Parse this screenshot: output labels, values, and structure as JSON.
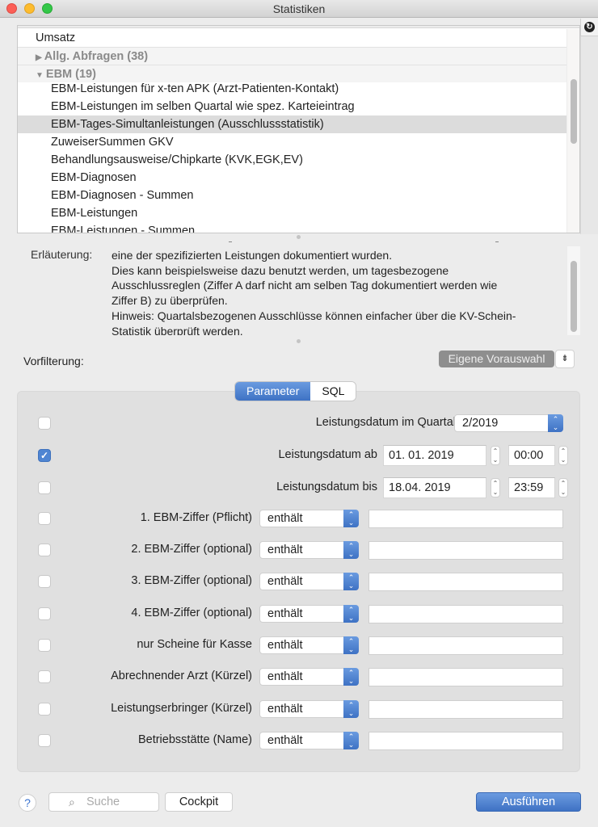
{
  "window": {
    "title": "Statistiken"
  },
  "list": {
    "rows": [
      {
        "label": "Umsatz",
        "kind": "top"
      },
      {
        "label": "Allg. Abfragen (38)",
        "kind": "group",
        "expanded": false,
        "toggle": "▶"
      },
      {
        "label": "EBM (19)",
        "kind": "group",
        "expanded": true,
        "toggle": "▼"
      },
      {
        "label": "EBM-Leistungen für x-ten APK (Arzt-Patienten-Kontakt)",
        "kind": "item"
      },
      {
        "label": "EBM-Leistungen im selben Quartal wie spez. Karteieintrag",
        "kind": "item"
      },
      {
        "label": "EBM-Tages-Simultanleistungen (Ausschlussstatistik)",
        "kind": "item",
        "selected": true
      },
      {
        "label": "ZuweiserSummen GKV",
        "kind": "item"
      },
      {
        "label": "Behandlungsausweise/Chipkarte (KVK,EGK,EV)",
        "kind": "item"
      },
      {
        "label": "EBM-Diagnosen",
        "kind": "item"
      },
      {
        "label": "EBM-Diagnosen - Summen",
        "kind": "item"
      },
      {
        "label": "EBM-Leistungen",
        "kind": "item"
      },
      {
        "label": "EBM-Leistungen - Summen",
        "kind": "item"
      }
    ]
  },
  "icons": {
    "refresh": "↻",
    "checkmark": "✓",
    "popup_arrows": "⌃⌄",
    "stepper_up": "⌃",
    "stepper_down": "⌄",
    "filter_menu": "⇟",
    "help": "?",
    "search": "⌕"
  },
  "description": {
    "label": "Erläuterung:",
    "lines": [
      "eine der spezifizierten Leistungen dokumentiert wurden.",
      "Dies kann beispielsweise dazu benutzt werden, um tagesbezogene",
      "Ausschlussreglen (Ziffer A darf nicht am selben Tag dokumentiert werden wie",
      "Ziffer B) zu überprüfen.",
      "Hinweis: Quartalsbezogenen Ausschlüsse können einfacher über die KV-Schein-",
      "Statistik überprüft werden."
    ]
  },
  "prefilter": {
    "label": "Vorfilterung:",
    "button_label": "Eigene Vorauswahl"
  },
  "tabs": [
    {
      "label": "Parameter",
      "active": true
    },
    {
      "label": "SQL",
      "active": false
    }
  ],
  "params": {
    "quarter": {
      "label": "Leistungsdatum im Quartal",
      "value": "2/2019",
      "checked": false
    },
    "date_from": {
      "label": "Leistungsdatum ab",
      "date": "01. 01. 2019",
      "time": "00:00",
      "checked": true
    },
    "date_to": {
      "label": "Leistungsdatum bis",
      "date": "18.04. 2019",
      "time": "23:59",
      "checked": false
    },
    "filters": [
      {
        "label": "1. EBM-Ziffer (Pflicht)",
        "operator": "enthält",
        "value": "",
        "checked": false
      },
      {
        "label": "2. EBM-Ziffer (optional)",
        "operator": "enthält",
        "value": "",
        "checked": false
      },
      {
        "label": "3. EBM-Ziffer (optional)",
        "operator": "enthält",
        "value": "",
        "checked": false
      },
      {
        "label": "4. EBM-Ziffer (optional)",
        "operator": "enthält",
        "value": "",
        "checked": false
      },
      {
        "label": "nur Scheine für Kasse",
        "operator": "enthält",
        "value": "",
        "checked": false
      },
      {
        "label": "Abrechnender Arzt (Kürzel)",
        "operator": "enthält",
        "value": "",
        "checked": false
      },
      {
        "label": "Leistungserbringer (Kürzel)",
        "operator": "enthält",
        "value": "",
        "checked": false
      },
      {
        "label": "Betriebsstätte (Name)",
        "operator": "enthält",
        "value": "",
        "checked": false
      }
    ]
  },
  "footer": {
    "search_placeholder": "Suche",
    "cockpit_label": "Cockpit",
    "run_label": "Ausführen"
  },
  "colors": {
    "accent": "#4a7fd0",
    "selection": "#dcdcdc",
    "prefilter_button": "#8e8e8e"
  }
}
